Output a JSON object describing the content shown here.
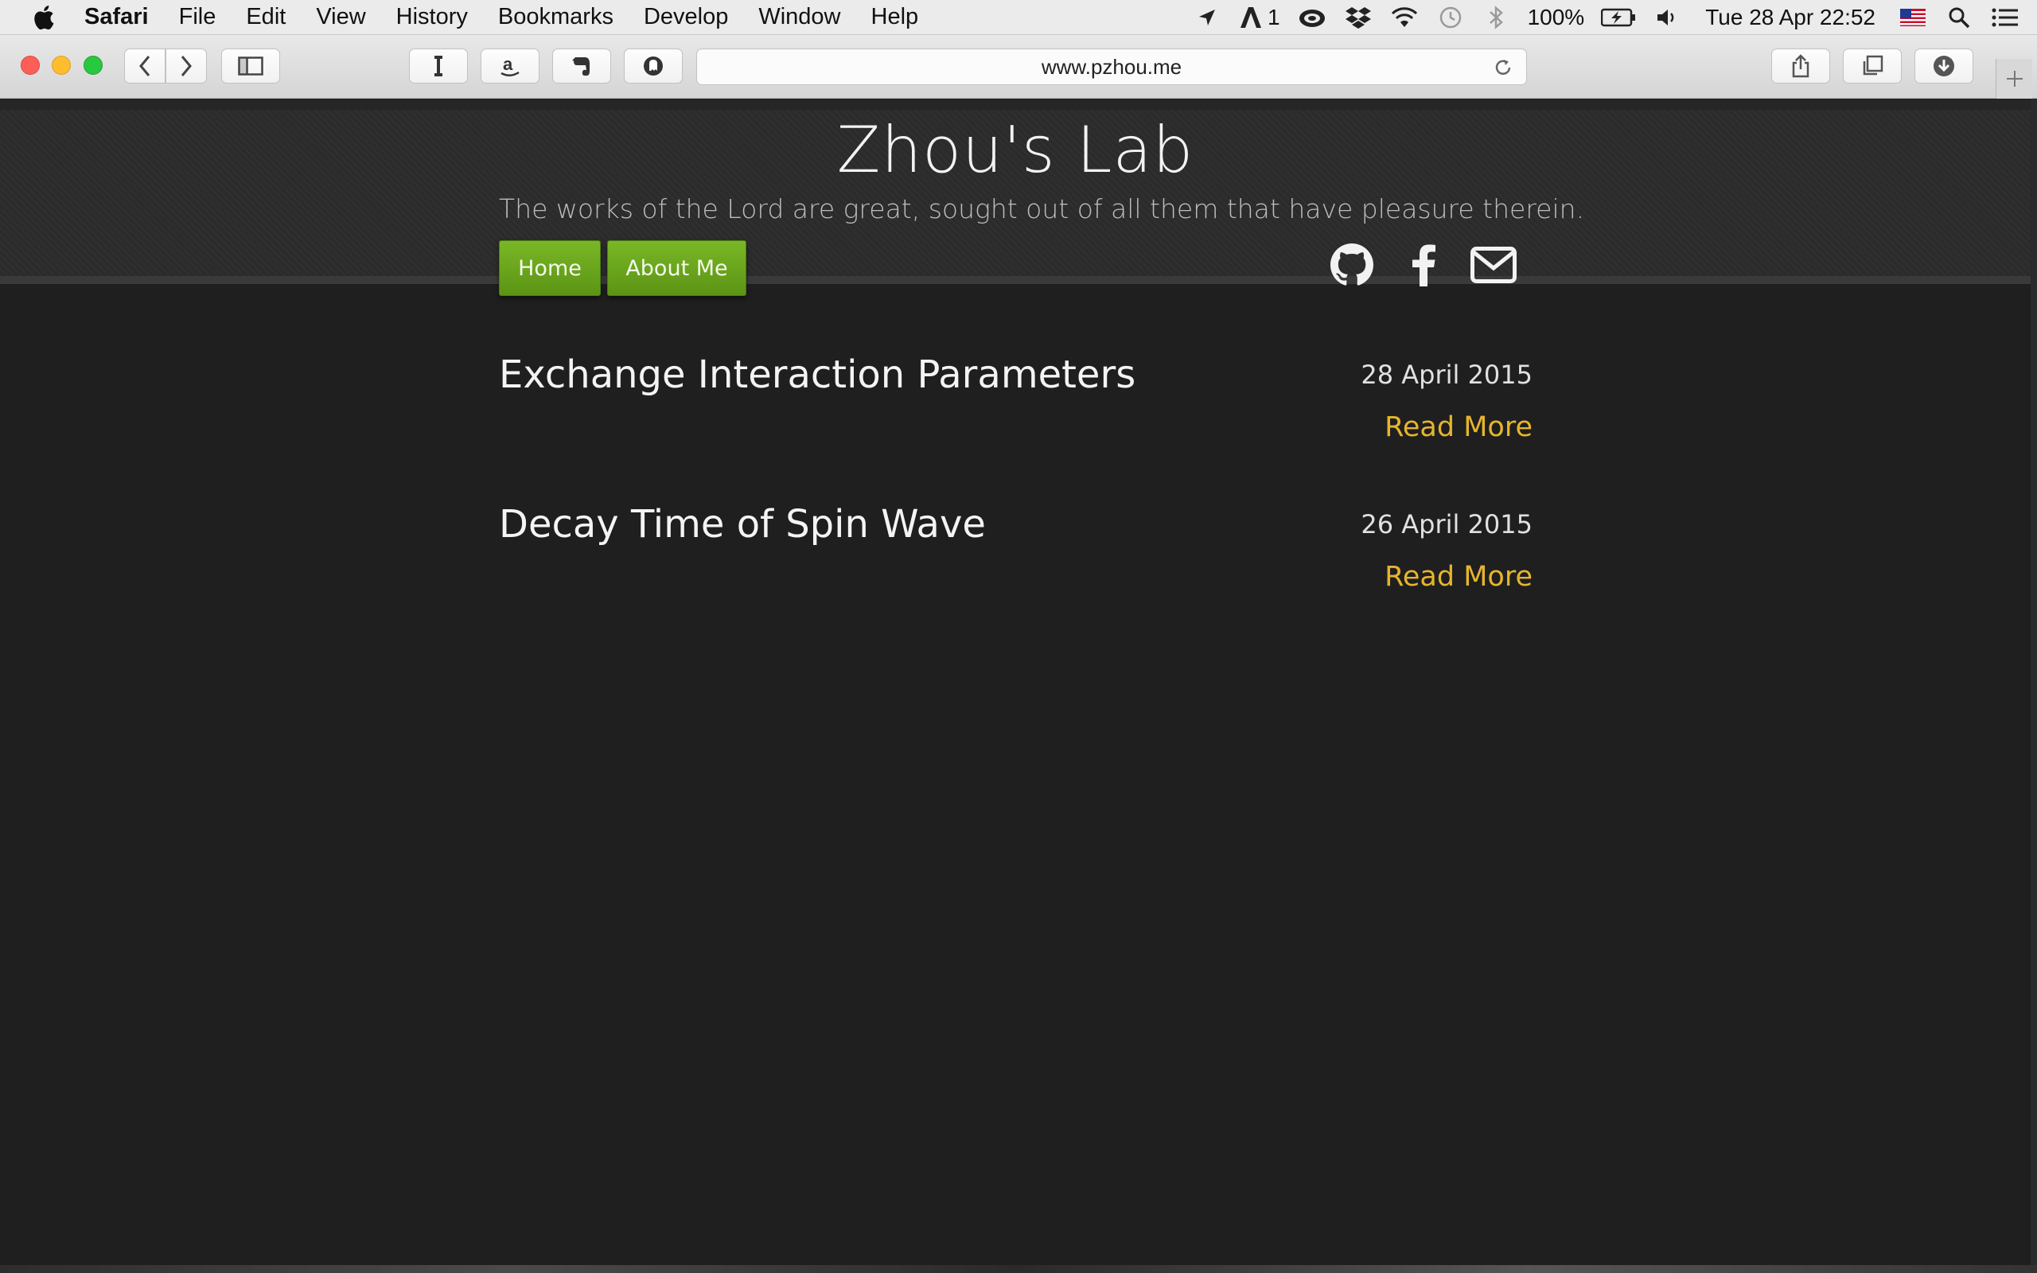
{
  "menubar": {
    "app_name": "Safari",
    "items": [
      "File",
      "Edit",
      "View",
      "History",
      "Bookmarks",
      "Develop",
      "Window",
      "Help"
    ],
    "status": {
      "adobe_count": "1",
      "battery": "100%",
      "clock": "Tue 28 Apr  22:52"
    }
  },
  "browser": {
    "url": "www.pzhou.me"
  },
  "site": {
    "title": "Zhou's Lab",
    "tagline": "The works of the Lord are great, sought out of all them that have pleasure therein.",
    "nav": {
      "home": "Home",
      "about": "About Me"
    },
    "posts": [
      {
        "title": "Exchange Interaction Parameters",
        "date": "28 April 2015",
        "more": "Read More"
      },
      {
        "title": "Decay Time of Spin Wave",
        "date": "26 April 2015",
        "more": "Read More"
      }
    ]
  },
  "colors": {
    "accent_green": "#6aa51d",
    "read_more": "#e6b52c",
    "page_bg": "#1f1f1f"
  }
}
